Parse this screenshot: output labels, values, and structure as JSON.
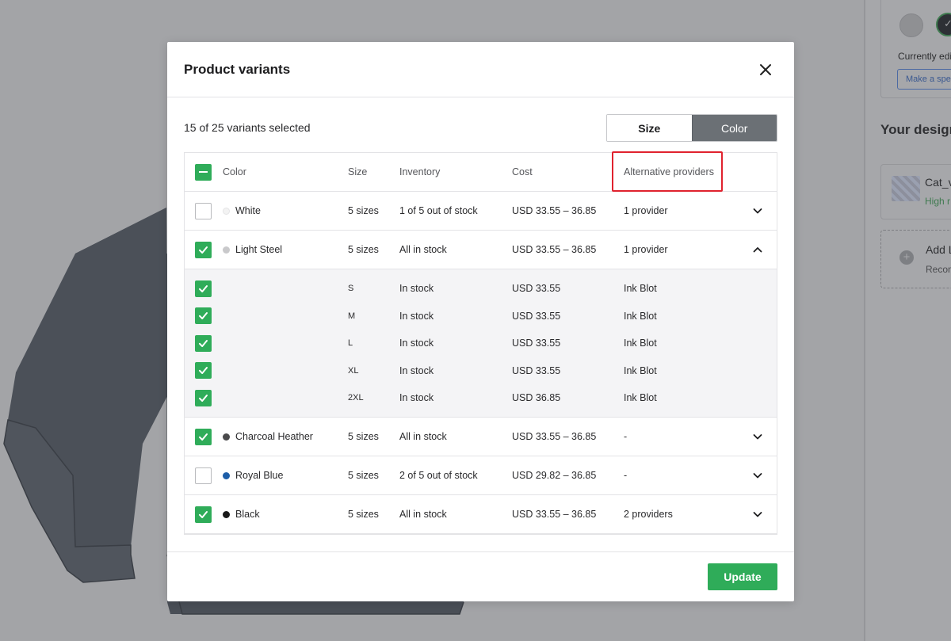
{
  "background": {
    "sidebar": {
      "currently_editing": "Currently edi",
      "make_button": "Make a spe",
      "your_design_title": "Your design",
      "file_name": "Cat_v",
      "file_resolution": "High r",
      "add_title": "Add L",
      "add_subtitle": "Recon"
    }
  },
  "modal": {
    "title": "Product variants",
    "selected_count": "15 of 25 variants selected",
    "toggle": {
      "size_label": "Size",
      "color_label": "Color",
      "active": "Color"
    },
    "columns": {
      "color": "Color",
      "size": "Size",
      "inventory": "Inventory",
      "cost": "Cost",
      "alt_providers": "Alternative providers"
    },
    "rows": [
      {
        "checked": false,
        "color": "White",
        "dot": "#f3f3f3",
        "size": "5 sizes",
        "inventory": "1 of 5 out of stock",
        "cost": "USD 33.55 – 36.85",
        "alt": "1 provider",
        "expanded": false
      },
      {
        "checked": true,
        "color": "Light Steel",
        "dot": "#c9c9cb",
        "size": "5 sizes",
        "inventory": "All in stock",
        "cost": "USD 33.55 – 36.85",
        "alt": "1 provider",
        "expanded": true
      },
      {
        "checked": true,
        "color": "Charcoal Heather",
        "dot": "#4a4a4c",
        "size": "5 sizes",
        "inventory": "All in stock",
        "cost": "USD 33.55 – 36.85",
        "alt": "-",
        "expanded": false
      },
      {
        "checked": false,
        "color": "Royal Blue",
        "dot": "#1d5ea8",
        "size": "5 sizes",
        "inventory": "2 of 5 out of stock",
        "cost": "USD 29.82 – 36.85",
        "alt": "-",
        "expanded": false
      },
      {
        "checked": true,
        "color": "Black",
        "dot": "#1a1a1a",
        "size": "5 sizes",
        "inventory": "All in stock",
        "cost": "USD 33.55 – 36.85",
        "alt": "2 providers",
        "expanded": false
      }
    ],
    "subrows": [
      {
        "checked": true,
        "size": "S",
        "inventory": "In stock",
        "cost": "USD 33.55",
        "alt": "Ink Blot"
      },
      {
        "checked": true,
        "size": "M",
        "inventory": "In stock",
        "cost": "USD 33.55",
        "alt": "Ink Blot"
      },
      {
        "checked": true,
        "size": "L",
        "inventory": "In stock",
        "cost": "USD 33.55",
        "alt": "Ink Blot"
      },
      {
        "checked": true,
        "size": "XL",
        "inventory": "In stock",
        "cost": "USD 33.55",
        "alt": "Ink Blot"
      },
      {
        "checked": true,
        "size": "2XL",
        "inventory": "In stock",
        "cost": "USD 36.85",
        "alt": "Ink Blot"
      }
    ],
    "update_label": "Update"
  },
  "colors": {
    "accent_green": "#2fac59",
    "highlight_red": "#e0222e",
    "toggle_active": "#6b7075"
  },
  "icons": {
    "close": "close-icon",
    "chevron_down": "chevron-down-icon",
    "chevron_up": "chevron-up-icon",
    "check": "check-icon",
    "plus": "plus-icon"
  }
}
